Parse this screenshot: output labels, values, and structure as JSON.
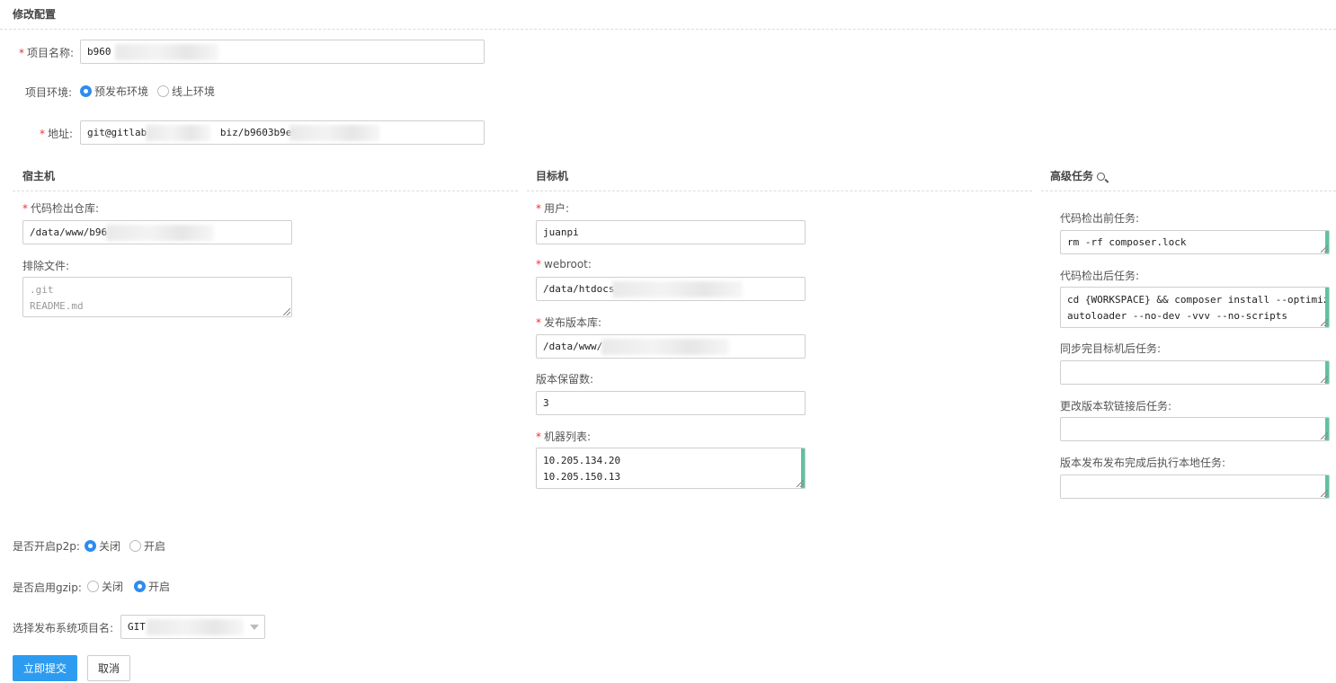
{
  "page_title": "修改配置",
  "project_name": {
    "label": "项目名称:",
    "value": "b960"
  },
  "env": {
    "label": "项目环境:",
    "options": [
      "预发布环境",
      "线上环境"
    ],
    "selected": "预发布环境"
  },
  "address": {
    "label": "地址:",
    "value_prefix": "git@gitlab.",
    "value_suffix": "biz/b9603b9ece8"
  },
  "host": {
    "title": "宿主机",
    "repo": {
      "label": "代码检出仓库:",
      "value": "/data/www/b96"
    },
    "exclude": {
      "label": "排除文件:",
      "lines": [
        ".git",
        "README.md"
      ]
    }
  },
  "target": {
    "title": "目标机",
    "user": {
      "label": "用户:",
      "value": "juanpi"
    },
    "webroot": {
      "label": "webroot:",
      "value": "/data/htdocs/"
    },
    "release_lib": {
      "label": "发布版本库:",
      "value": "/data/www/"
    },
    "keep_versions": {
      "label": "版本保留数:",
      "value": "3"
    },
    "machines": {
      "label": "机器列表:",
      "lines": [
        "10.205.134.20",
        "10.205.150.13"
      ]
    }
  },
  "advanced": {
    "title": "高级任务",
    "pre_checkout": {
      "label": "代码检出前任务:",
      "lines": [
        "rm -rf composer.lock"
      ]
    },
    "post_checkout": {
      "label": "代码检出后任务:",
      "lines": [
        "cd {WORKSPACE} &&  composer install --optimize-",
        "autoloader --no-dev -vvv  --no-scripts"
      ]
    },
    "post_sync": {
      "label": "同步完目标机后任务:",
      "lines": []
    },
    "post_link": {
      "label": "更改版本软链接后任务:",
      "lines": []
    },
    "post_release_local": {
      "label": "版本发布发布完成后执行本地任务:",
      "lines": []
    }
  },
  "p2p": {
    "label": "是否开启p2p:",
    "options": [
      "关闭",
      "开启"
    ],
    "selected": "关闭"
  },
  "gzip": {
    "label": "是否启用gzip:",
    "options": [
      "关闭",
      "开启"
    ],
    "selected": "开启"
  },
  "release_project": {
    "label": "选择发布系统项目名:",
    "value": "GIT"
  },
  "buttons": {
    "submit": "立即提交",
    "cancel": "取消"
  }
}
